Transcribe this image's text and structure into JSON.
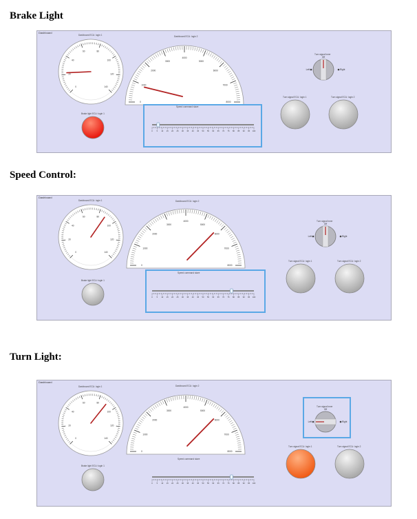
{
  "sections": [
    {
      "heading": "Brake Light",
      "panel_title": "Dashboard",
      "gauge_left_label": "Dashboard ECU: login 1",
      "gauge_left_needle": 22,
      "gauge_left_ticks": [
        "0",
        "20",
        "40",
        "60",
        "80",
        "100",
        "120",
        "140"
      ],
      "gauge_right_label": "Dashboard ECU: login 2",
      "gauge_right_needle": 900,
      "gauge_right_ticks": [
        "0",
        "1000",
        "2000",
        "3000",
        "4000",
        "5000",
        "6000",
        "7000",
        "8000"
      ],
      "brake_label": "Brake light ECU: login 1",
      "brake_on": true,
      "slider_label": "Speed command slave",
      "slider_value": 6,
      "slider_ticks": [
        "0",
        "5",
        "10",
        "15",
        "20",
        "25",
        "30",
        "35",
        "40",
        "45",
        "50",
        "55",
        "60",
        "65",
        "70",
        "75",
        "80",
        "85",
        "90",
        "95",
        "100"
      ],
      "turn_label": "Turn signal lever",
      "turn_off": "Off",
      "turn_left": "Left",
      "turn_right": "Right",
      "turn_state": "off",
      "turn_left_lamp_label": "Turn signal ECU: login 1",
      "turn_right_lamp_label": "Turn signal ECU: login 2",
      "turn_left_on": false,
      "turn_right_on": false,
      "selected": "slider"
    },
    {
      "heading": "Speed Control:",
      "panel_title": "Dashboard",
      "gauge_left_label": "Dashboard ECU: login 1",
      "gauge_left_needle": 88,
      "gauge_left_ticks": [
        "0",
        "20",
        "40",
        "60",
        "80",
        "100",
        "120",
        "140"
      ],
      "gauge_right_label": "Dashboard ECU: login 2",
      "gauge_right_needle": 5800,
      "gauge_right_ticks": [
        "0",
        "1000",
        "2000",
        "3000",
        "4000",
        "5000",
        "6000",
        "7000",
        "8000"
      ],
      "brake_label": "Brake light ECU: login 1",
      "brake_on": false,
      "slider_label": "Speed command slave",
      "slider_value": 78,
      "slider_ticks": [
        "0",
        "5",
        "10",
        "15",
        "20",
        "25",
        "30",
        "35",
        "40",
        "45",
        "50",
        "55",
        "60",
        "65",
        "70",
        "75",
        "80",
        "85",
        "90",
        "95",
        "100"
      ],
      "turn_label": "Turn signal lever",
      "turn_off": "Off",
      "turn_left": "Left",
      "turn_right": "Right",
      "turn_state": "off",
      "turn_left_lamp_label": "Turn signal ECU: login 1",
      "turn_right_lamp_label": "Turn signal ECU: login 2",
      "turn_left_on": false,
      "turn_right_on": false,
      "selected": "slider"
    },
    {
      "heading": "Turn Light:",
      "panel_title": "Dashboard",
      "gauge_left_label": "Dashboard ECU: login 1",
      "gauge_left_needle": 90,
      "gauge_left_ticks": [
        "0",
        "20",
        "40",
        "60",
        "80",
        "100",
        "120",
        "140"
      ],
      "gauge_right_label": "Dashboard ECU: login 2",
      "gauge_right_needle": 5800,
      "gauge_right_ticks": [
        "0",
        "1000",
        "2000",
        "3000",
        "4000",
        "5000",
        "6000",
        "7000",
        "8000"
      ],
      "brake_label": "Brake light ECU: login 1",
      "brake_on": false,
      "slider_label": "Speed command slave",
      "slider_value": 78,
      "slider_ticks": [
        "0",
        "5",
        "10",
        "15",
        "20",
        "25",
        "30",
        "35",
        "40",
        "45",
        "50",
        "55",
        "60",
        "65",
        "70",
        "75",
        "80",
        "85",
        "90",
        "95",
        "100"
      ],
      "turn_label": "Turn signal lever",
      "turn_off": "Off",
      "turn_left": "Left",
      "turn_right": "Right",
      "turn_state": "left",
      "turn_left_lamp_label": "Turn signal ECU: login 1",
      "turn_right_lamp_label": "Turn signal ECU: login 2",
      "turn_left_on": true,
      "turn_right_on": false,
      "selected": "turn"
    }
  ],
  "colors": {
    "panel_bg": "#dcdcf4",
    "needle": "#b22222",
    "brake_on": "#e8160c",
    "turn_on": "#f05a14",
    "lamp_off": "#c8c8c8",
    "selection": "#5aa8e6"
  }
}
